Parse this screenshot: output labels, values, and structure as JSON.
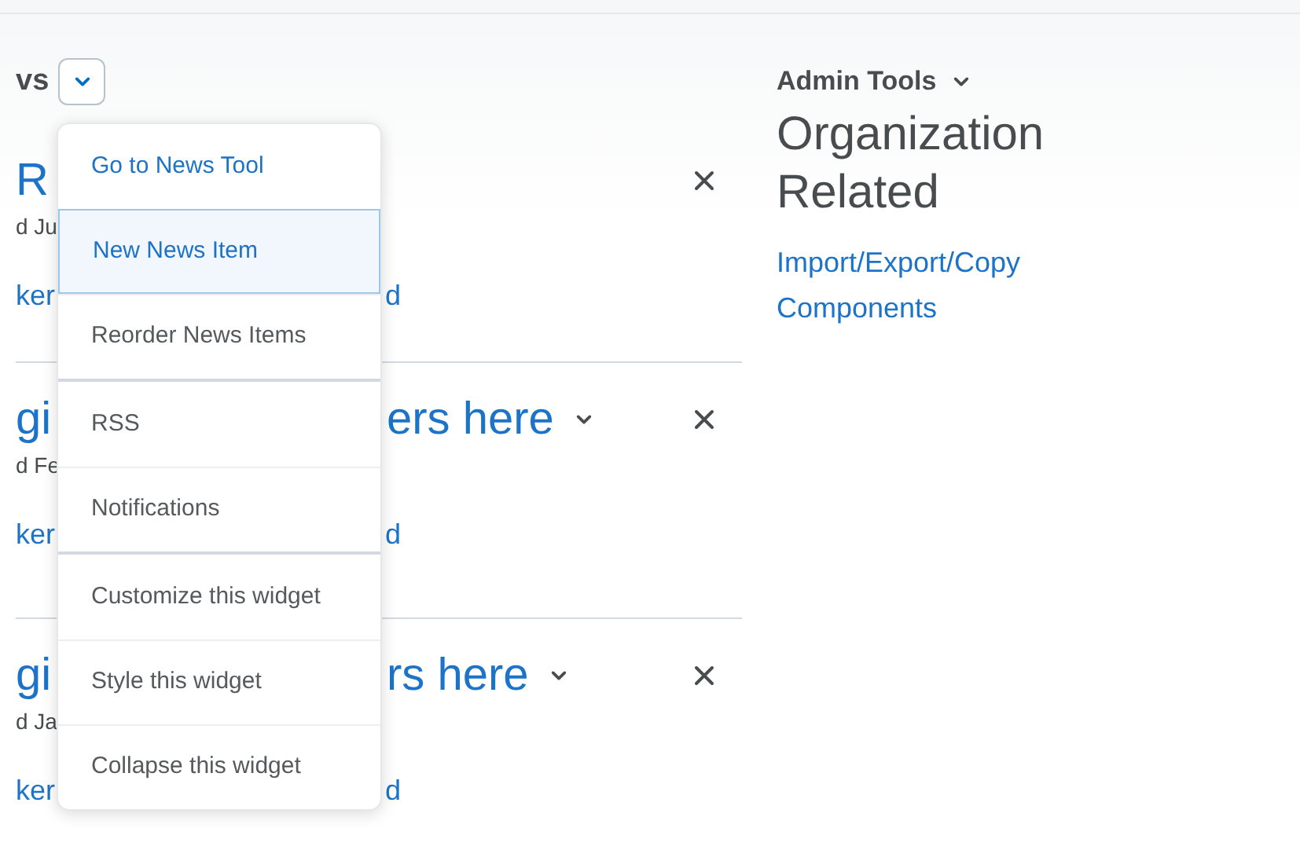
{
  "news_widget": {
    "title_fragment": "vs",
    "items": [
      {
        "title_left": "R",
        "meta_left": "d Ju",
        "link_left": "ker",
        "link_right": "d"
      },
      {
        "title_left": "gi",
        "title_right": "ers here",
        "meta_left": "d Fe",
        "link_left": "ker",
        "link_right": "d"
      },
      {
        "title_left": "gi",
        "title_right": "rs here",
        "meta_left": "d Ja",
        "link_left": "ker",
        "link_right": "d"
      }
    ]
  },
  "menu": {
    "groups": [
      [
        {
          "label": "Go to News Tool",
          "kind": "link",
          "selected": false
        },
        {
          "label": "New News Item",
          "kind": "link",
          "selected": true
        },
        {
          "label": "Reorder News Items",
          "kind": "action",
          "selected": false
        }
      ],
      [
        {
          "label": "RSS",
          "kind": "action",
          "selected": false
        },
        {
          "label": "Notifications",
          "kind": "action",
          "selected": false
        }
      ],
      [
        {
          "label": "Customize this widget",
          "kind": "action",
          "selected": false
        },
        {
          "label": "Style this widget",
          "kind": "action",
          "selected": false
        },
        {
          "label": "Collapse this widget",
          "kind": "action",
          "selected": false
        }
      ]
    ]
  },
  "admin_tools": {
    "title": "Admin Tools",
    "heading": "Organization Related",
    "links": [
      "Import/Export/Copy Components"
    ]
  }
}
